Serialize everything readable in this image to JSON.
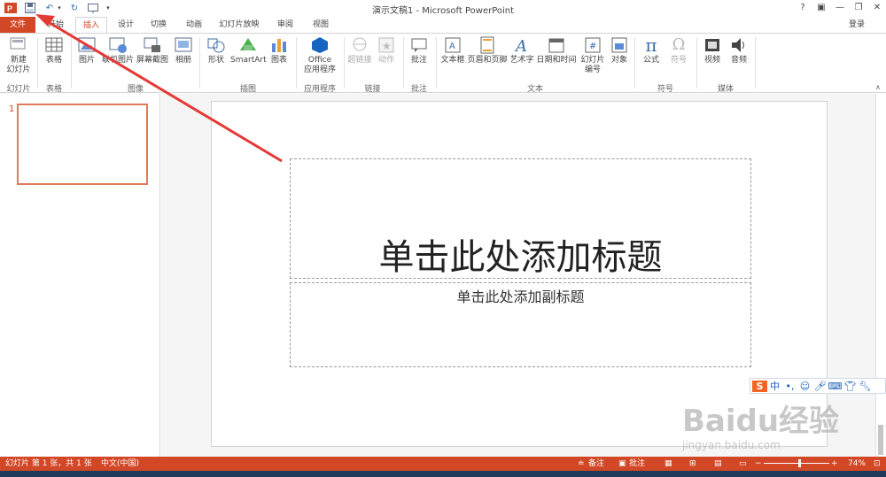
{
  "titlebar": {
    "title": "演示文稿1 - Microsoft PowerPoint",
    "help": "?",
    "login": "登录"
  },
  "tabs": [
    {
      "label": "文件"
    },
    {
      "label": "开始"
    },
    {
      "label": "插入"
    },
    {
      "label": "设计"
    },
    {
      "label": "切换"
    },
    {
      "label": "动画"
    },
    {
      "label": "幻灯片放映"
    },
    {
      "label": "审阅"
    },
    {
      "label": "视图"
    }
  ],
  "ribbon": {
    "buttons": {
      "new_slide": "新建\n幻灯片",
      "table": "表格",
      "picture": "图片",
      "online_picture": "联机图片",
      "screenshot": "屏幕截图",
      "album": "相册",
      "shapes": "形状",
      "smartart": "SmartArt",
      "chart": "图表",
      "office_apps": "Office\n应用程序",
      "hyperlink": "超链接",
      "action": "动作",
      "comment": "批注",
      "textbox": "文本框",
      "header_footer": "页眉和页脚",
      "wordart": "艺术字",
      "datetime": "日期和时间",
      "slide_number": "幻灯片\n编号",
      "object": "对象",
      "equation": "公式",
      "symbol": "符号",
      "video": "视频",
      "audio": "音频"
    },
    "groups": {
      "slides": "幻灯片",
      "tables": "表格",
      "images": "图像",
      "illustrations": "插图",
      "apps": "应用程序",
      "links": "链接",
      "comments": "批注",
      "text": "文本",
      "symbols": "符号",
      "media": "媒体"
    }
  },
  "thumbnails": [
    {
      "number": "1"
    }
  ],
  "slide": {
    "title_placeholder": "单击此处添加标题",
    "subtitle_placeholder": "单击此处添加副标题"
  },
  "statusbar": {
    "slide_info": "幻灯片 第 1 张，共 1 张",
    "language": "中文(中国)",
    "notes": "备注",
    "comments": "批注",
    "zoom": "74%"
  },
  "ime": {
    "lang": "中"
  },
  "watermark": {
    "text": "Baidu经验",
    "url": "jingyan.baidu.com"
  },
  "colors": {
    "accent": "#d24726",
    "annotation_arrow": "#e53935"
  }
}
